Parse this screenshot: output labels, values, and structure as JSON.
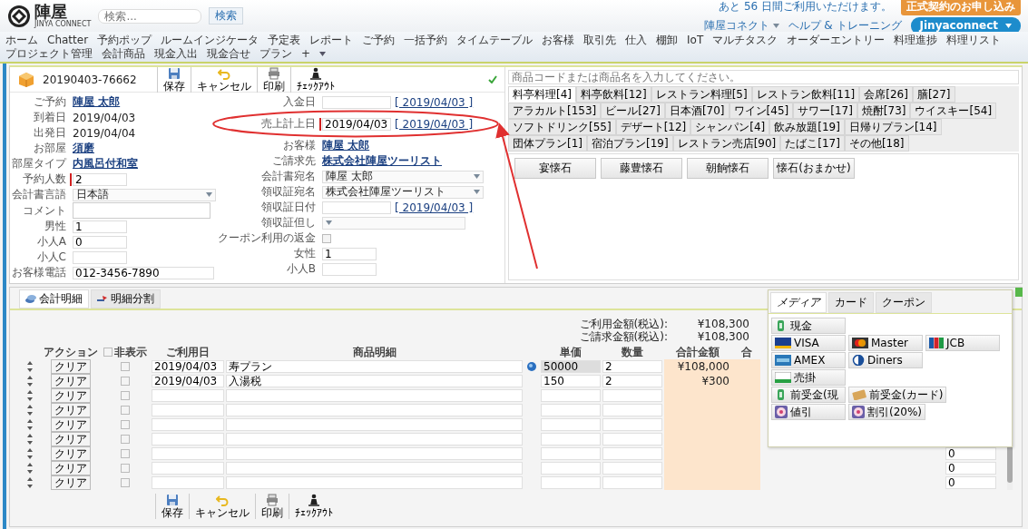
{
  "header": {
    "logo_text": "陣屋",
    "logo_subtitle": "JINYA CONNECT",
    "search": {
      "placeholder": "検索..."
    },
    "search_button": "検索",
    "trial_notice": "あと 56 日間ご利用いただけます。",
    "signup_button": "正式契約のお申し込み",
    "links": [
      {
        "label": "陣屋コネクト",
        "has_menu": true
      },
      {
        "label": "ヘルプ & トレーニング",
        "has_menu": false
      }
    ],
    "app_menu": {
      "label": "Jinyaconnect",
      "has_menu": true
    }
  },
  "nav": [
    {
      "label": "ホーム"
    },
    {
      "label": "Chatter"
    },
    {
      "label": "予約ポップ"
    },
    {
      "label": "ルームインジケータ"
    },
    {
      "label": "予定表"
    },
    {
      "label": "レポート"
    },
    {
      "label": "ご予約"
    },
    {
      "label": "一括予約"
    },
    {
      "label": "タイムテーブル"
    },
    {
      "label": "お客様"
    },
    {
      "label": "取引先"
    },
    {
      "label": "仕入"
    },
    {
      "label": "棚卸"
    },
    {
      "label": "IoT"
    },
    {
      "label": "マルチタスク"
    },
    {
      "label": "オーダーエントリー"
    },
    {
      "label": "料理進捗"
    },
    {
      "label": "料理リスト"
    },
    {
      "label": "プロジェクト管理"
    },
    {
      "label": "会計商品"
    },
    {
      "label": "現金入出"
    },
    {
      "label": "現金合せ"
    },
    {
      "label": "プラン"
    },
    {
      "label": "+"
    }
  ],
  "record": {
    "number": "20190403-76662",
    "saved": true,
    "toolbar": [
      {
        "kind": "save",
        "label": "保存"
      },
      {
        "kind": "cancel",
        "label": "キャンセル"
      },
      {
        "kind": "print",
        "label": "印刷"
      },
      {
        "kind": "checkout",
        "label": "ﾁｪｯｸｱｳﾄ"
      }
    ],
    "left_fields": [
      {
        "label": "ご予約",
        "kind": "link",
        "value": "陣屋 太郎",
        "required": false
      },
      {
        "label": "到着日",
        "kind": "text",
        "value": "2019/04/03",
        "required": false
      },
      {
        "label": "出発日",
        "kind": "text",
        "value": "2019/04/04",
        "required": false
      },
      {
        "label": "お部屋",
        "kind": "link",
        "value": "須磨",
        "required": false
      },
      {
        "label": "部屋タイプ",
        "kind": "link",
        "value": "内風呂付和室",
        "required": false
      },
      {
        "label": "予約人数",
        "kind": "input",
        "value": "2",
        "required": true
      },
      {
        "label": "会計書言語",
        "kind": "select",
        "value": "日本語",
        "required": false
      },
      {
        "label": "コメント",
        "kind": "textarea",
        "required": false
      },
      {
        "label": "男性",
        "kind": "input",
        "value": "1",
        "required": false
      },
      {
        "label": "小人A",
        "kind": "input",
        "value": "0",
        "required": false
      },
      {
        "label": "小人C",
        "kind": "input",
        "required": false
      },
      {
        "label": "お客様電話",
        "kind": "wide",
        "value": "012-3456-7890",
        "required": false
      }
    ],
    "right_fields": [
      {
        "label": "入金日",
        "kind": "date",
        "date_link": "[ 2019/04/03 ]",
        "required": false,
        "annotated": false
      },
      {
        "label": "売上計上日",
        "kind": "date",
        "value": "2019/04/03",
        "date_link": "[ 2019/04/03 ]",
        "required": true,
        "annotated": true
      },
      {
        "label": "お客様",
        "kind": "link",
        "value": "陣屋 太郎",
        "required": false,
        "annotated": false
      },
      {
        "label": "ご請求先",
        "kind": "link",
        "value": "株式会社陣屋ツーリスト",
        "required": false,
        "annotated": false
      },
      {
        "label": "会計書宛名",
        "kind": "lookup",
        "value": "陣屋 太郎",
        "required": false,
        "annotated": false
      },
      {
        "label": "領収証宛名",
        "kind": "lookup",
        "value": "株式会社陣屋ツーリスト",
        "required": false,
        "annotated": false
      },
      {
        "label": "領収証日付",
        "kind": "date",
        "date_link": "[ 2019/04/03 ]",
        "required": false,
        "annotated": false
      },
      {
        "label": "領収証但し",
        "kind": "select",
        "required": false,
        "annotated": false
      },
      {
        "label": "クーポン利用の返金",
        "kind": "checkbox",
        "checked": false,
        "required": false,
        "annotated": false
      },
      {
        "label": "女性",
        "kind": "input",
        "value": "1",
        "required": false,
        "annotated": false
      },
      {
        "label": "小人B",
        "kind": "input",
        "required": false,
        "annotated": false
      }
    ]
  },
  "products": {
    "search": {
      "placeholder": "商品コードまたは商品名を入力してください。"
    },
    "tabs": [
      {
        "label": "料亭料理[4]",
        "selected": true
      },
      {
        "label": "料亭飲料[12]",
        "selected": false
      },
      {
        "label": "レストラン料理[5]",
        "selected": false
      },
      {
        "label": "レストラン飲料[11]",
        "selected": false
      },
      {
        "label": "会席[26]",
        "selected": false
      },
      {
        "label": "膳[27]",
        "selected": false
      },
      {
        "label": "アラカルト[153]",
        "selected": false
      },
      {
        "label": "ビール[27]",
        "selected": false
      },
      {
        "label": "日本酒[70]",
        "selected": false
      },
      {
        "label": "ワイン[45]",
        "selected": false
      },
      {
        "label": "サワー[17]",
        "selected": false
      },
      {
        "label": "焼酎[73]",
        "selected": false
      },
      {
        "label": "ウイスキー[54]",
        "selected": false
      },
      {
        "label": "ソフトドリンク[55]",
        "selected": false
      },
      {
        "label": "デザート[12]",
        "selected": false
      },
      {
        "label": "シャンパン[4]",
        "selected": false
      },
      {
        "label": "飲み放題[19]",
        "selected": false
      },
      {
        "label": "日帰りプラン[14]",
        "selected": false
      },
      {
        "label": "団体プラン[1]",
        "selected": false
      },
      {
        "label": "宿泊プラン[19]",
        "selected": false
      },
      {
        "label": "レストラン売店[90]",
        "selected": false
      },
      {
        "label": "たばこ[17]",
        "selected": false
      },
      {
        "label": "その他[18]",
        "selected": false
      }
    ],
    "items": [
      {
        "label": "宴懐石"
      },
      {
        "label": "藤豊懐石"
      },
      {
        "label": "朝餉懐石"
      },
      {
        "label": "懐石(おまかせ)"
      }
    ]
  },
  "ledger": {
    "tabs": [
      {
        "label": "会計明細",
        "kind": "ledger",
        "selected": true
      },
      {
        "label": "明細分割",
        "kind": "split",
        "selected": false
      }
    ],
    "totals": [
      {
        "label": "ご利用金額(税込):",
        "value": "¥108,300"
      },
      {
        "label": "ご請求金額(税込):",
        "value": "¥108,300"
      }
    ],
    "columns": [
      {
        "label": "アクション",
        "kind": "action"
      },
      {
        "label": "非表示",
        "kind": "checkbox",
        "checked": false
      },
      {
        "label": "ご利用日",
        "kind": "date"
      },
      {
        "label": "商品明細",
        "kind": "item"
      },
      {
        "label": "単価",
        "kind": "price"
      },
      {
        "label": "数量",
        "kind": "qty"
      },
      {
        "label": "合計金額",
        "kind": "total"
      },
      {
        "label": "合",
        "kind": "cut"
      }
    ],
    "rows": [
      {
        "action": "クリア",
        "hidden": false,
        "date": "2019/04/03",
        "item": "寿プラン",
        "info": true,
        "price": "50000",
        "qty": "2",
        "total": "¥108,000"
      },
      {
        "action": "クリア",
        "hidden": false,
        "date": "2019/04/03",
        "item": "入湯税",
        "info": false,
        "price": "150",
        "qty": "2",
        "total": "¥300"
      },
      {
        "action": "クリア",
        "hidden": false,
        "info": false
      },
      {
        "action": "クリア",
        "hidden": false,
        "info": false
      },
      {
        "action": "クリア",
        "hidden": false,
        "info": false
      },
      {
        "action": "クリア",
        "hidden": false,
        "info": false
      },
      {
        "action": "クリア",
        "hidden": false,
        "info": false,
        "column_10": "0"
      },
      {
        "action": "クリア",
        "hidden": false,
        "info": false,
        "column_10": "0"
      },
      {
        "action": "クリア",
        "hidden": false,
        "info": false,
        "column_10": "0"
      }
    ],
    "toolbar": [
      {
        "kind": "save",
        "label": "保存"
      },
      {
        "kind": "cancel",
        "label": "キャンセル"
      },
      {
        "kind": "print",
        "label": "印刷"
      },
      {
        "kind": "checkout",
        "label": "ﾁｪｯｸｱｳﾄ"
      }
    ]
  },
  "payment": {
    "tabs": [
      {
        "label": "メディア",
        "selected": true
      },
      {
        "label": "カード",
        "selected": false
      },
      {
        "label": "クーポン",
        "selected": false
      }
    ],
    "rows": [
      [
        {
          "label": "現金",
          "kind": "cash"
        }
      ],
      [
        {
          "label": "VISA",
          "kind": "visa"
        },
        {
          "label": "Master",
          "kind": "master"
        },
        {
          "label": "JCB",
          "kind": "jcb"
        }
      ],
      [
        {
          "label": "AMEX",
          "kind": "amex"
        },
        {
          "label": "Diners",
          "kind": "diners"
        }
      ],
      [
        {
          "label": "売掛",
          "kind": "credit"
        }
      ],
      [
        {
          "label": "前受金(現",
          "kind": "cash-advance"
        },
        {
          "label": "前受金(カード)",
          "kind": "card-advance"
        }
      ],
      [
        {
          "label": "値引",
          "kind": "discount"
        },
        {
          "label": "割引(20%)",
          "kind": "discount"
        }
      ]
    ]
  }
}
